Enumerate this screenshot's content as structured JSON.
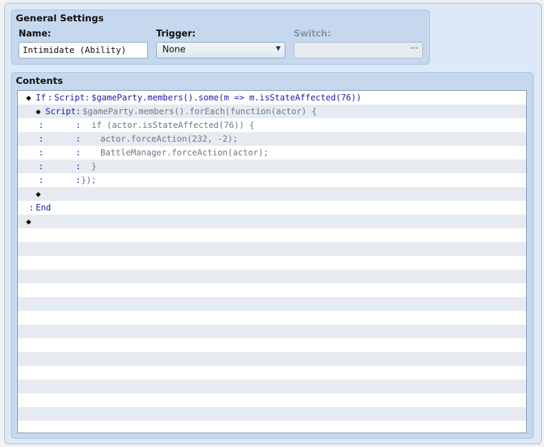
{
  "general": {
    "title": "General Settings",
    "name_label": "Name:",
    "name_value": "Intimidate (Ability)",
    "trigger_label": "Trigger:",
    "trigger_value": "None",
    "switch_label": "Switch:",
    "switch_button": "···"
  },
  "contents": {
    "title": "Contents",
    "lines": {
      "l0_keyword": "If",
      "l0_sep": ":",
      "l0_sub": "Script",
      "l0_sep2": ":",
      "l0_code": "$gameParty.members().some(m => m.isStateAffected(76))",
      "l1_keyword": "Script",
      "l1_sep": ":",
      "l1_code": "$gameParty.members().forEach(function(actor) {",
      "l2_code": "if (actor.isStateAffected(76)) {",
      "l3_code": "actor.forceAction(232, -2);",
      "l4_code": "BattleManager.forceAction(actor);",
      "l5_code": "}",
      "l6_code": "});",
      "l8_keyword": "End",
      "colon": ":"
    }
  }
}
